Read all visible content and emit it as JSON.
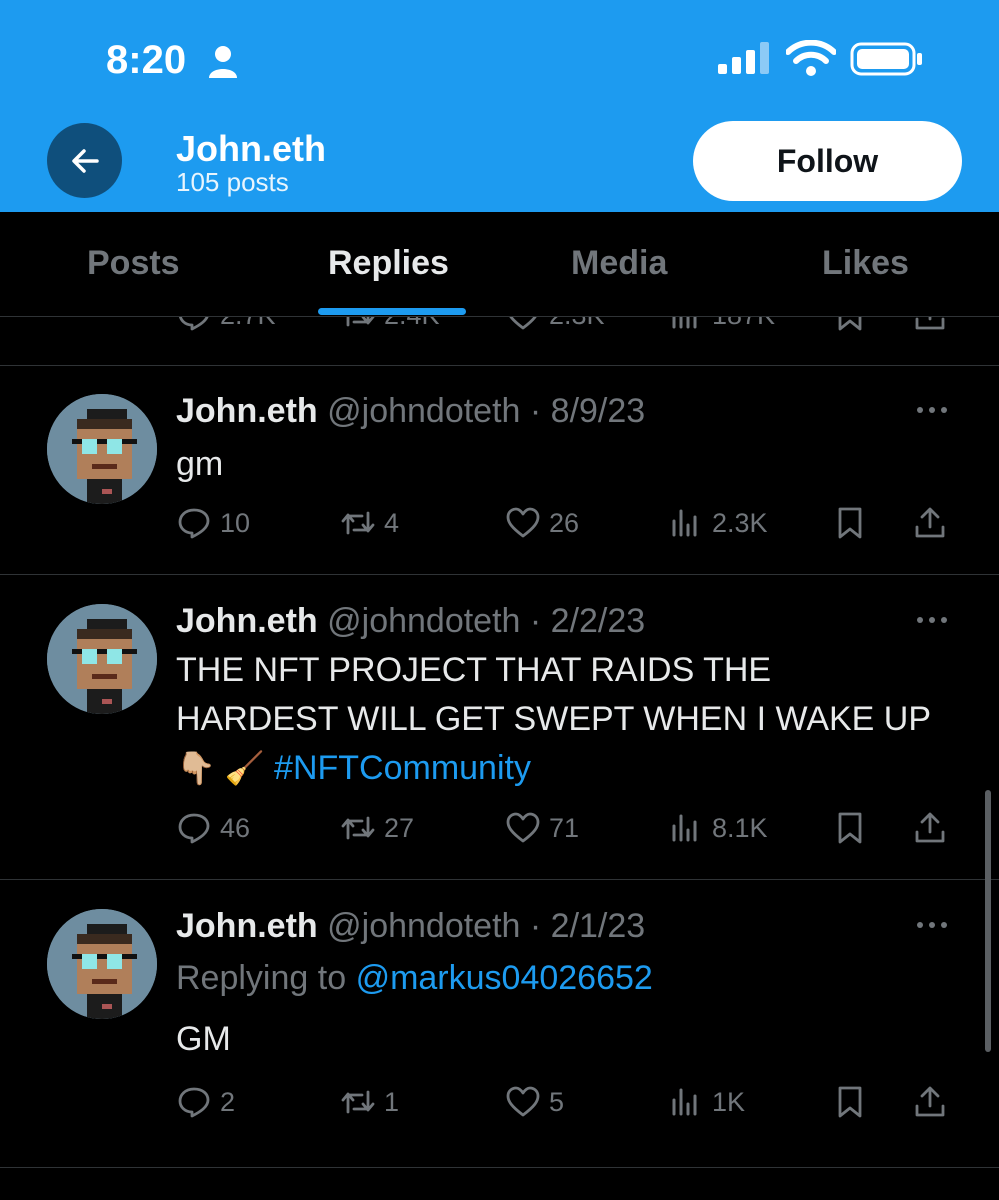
{
  "status_bar": {
    "time": "8:20"
  },
  "profile": {
    "name": "John.eth",
    "post_count": "105 posts",
    "follow_label": "Follow"
  },
  "tabs": [
    {
      "label": "Posts",
      "active": false
    },
    {
      "label": "Replies",
      "active": true
    },
    {
      "label": "Media",
      "active": false
    },
    {
      "label": "Likes",
      "active": false
    }
  ],
  "previous_tweet_counts": {
    "replies": "2.7K",
    "reposts": "2.4K",
    "likes": "2.3K",
    "views": "187K"
  },
  "tweets": [
    {
      "name": "John.eth",
      "handle": "@johndoteth",
      "separator": " · ",
      "date": "8/9/23",
      "text": "gm",
      "replies": "10",
      "reposts": "4",
      "likes": "26",
      "views": "2.3K"
    },
    {
      "name": "John.eth",
      "handle": "@johndoteth",
      "separator": " · ",
      "date": "2/2/23",
      "text": "THE NFT PROJECT THAT RAIDS THE HARDEST WILL GET SWEPT WHEN I WAKE UP",
      "emoji": "👇🏼 🧹",
      "hashtag": "#NFTCommunity",
      "replies": "46",
      "reposts": "27",
      "likes": "71",
      "views": "8.1K"
    },
    {
      "name": "John.eth",
      "handle": "@johndoteth",
      "separator": " · ",
      "date": "2/1/23",
      "replying_label": "Replying to",
      "replying_handle": "@markus04026652",
      "text": "GM",
      "replies": "2",
      "reposts": "1",
      "likes": "5",
      "views": "1K"
    }
  ],
  "colors": {
    "header_bg": "#1d9bf0",
    "background": "#000000",
    "accent": "#1d9bf0",
    "muted": "#71767b"
  }
}
